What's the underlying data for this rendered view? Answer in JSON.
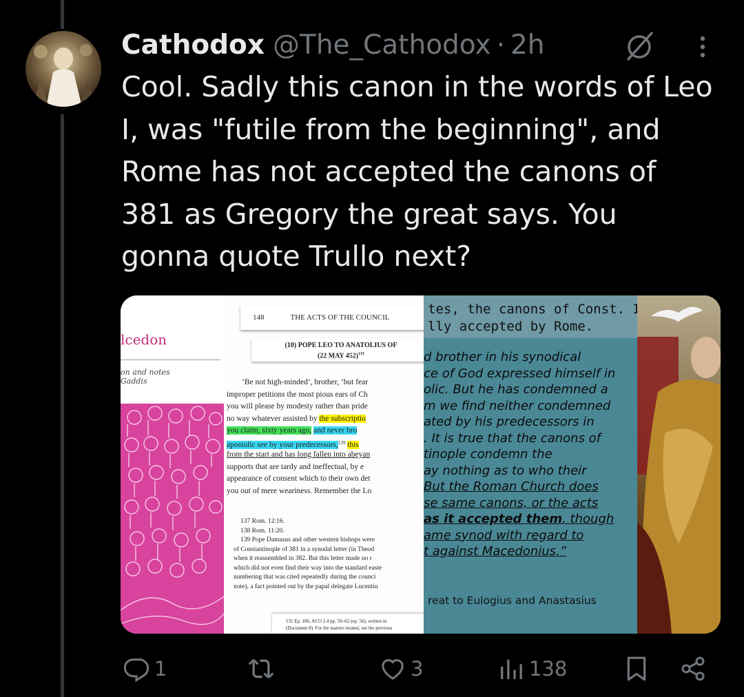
{
  "tweet": {
    "display_name": "Cathodox",
    "handle": "@The_Cathodox",
    "separator": "·",
    "time": "2h",
    "text": "Cool. Sadly this canon in the words of Leo I, was \"futile from the beginning\", and Rome has not accepted the canons of 381 as Gregory the great says. You gonna quote Trullo next?"
  },
  "media": {
    "book_cover": {
      "title": "lcedon",
      "subtitle_1": "on and notes",
      "subtitle_2": "Gaddis"
    },
    "book_page": {
      "page_number": "148",
      "running_title": "THE ACTS OF THE COUNCIL",
      "section_title": "(10) POPE LEO TO ANATOLIUS OF",
      "section_date": "(22 MAY 452)",
      "section_sup": "131",
      "lines": [
        "‘Be not high-minded’, brother, ‘but fear",
        "improper petitions the most pious ears of Ch",
        "you will please by modesty rather than pride",
        "no way whatever assisted by",
        "the subscriptio",
        "you claim, sixty years ago,",
        "and never bro",
        "apostolic see by your predecessors,",
        "139",
        "this",
        "from the start and has long fallen into abeyan",
        "supports that are tardy and ineffectual, by e",
        "appearance of consent which to their own det",
        "you out of mere weariness. Remember the Lo"
      ],
      "notes": [
        "137  Rom. 12:16.",
        "138  Rom. 11:20.",
        "139  Pope Damasus and other western bishops were",
        "of Constantinople of 381 in a synodal letter (in Theod",
        "when it reassembled in 382. But this letter made no r",
        "which did not even find their way into the standard easte",
        "numbering that was cited repeatedly during the counci",
        "note), a fact pointed out by the papal delegate Lucentiu"
      ],
      "footnote_1": "131  Ep. 106, ACO 2.4 pp. 59–62 (ep. 56), written in",
      "footnote_2": "(Document 8). For the matters treated, see the previous"
    },
    "teal_page": {
      "head_1": "tes, the canons of Const. I",
      "head_2": "lly accepted by Rome.",
      "quote": [
        "d brother in his synodical",
        "ce of God expressed himself in",
        "olic. But he has condemned a",
        "m we find neither condemned",
        "ated by his predecessors in",
        ". It is true that the canons of",
        "tinople condemn the",
        "ay nothing as to who their",
        "But the Roman Church does",
        "se same canons, or the acts",
        "as it accepted them",
        ", though",
        "ame synod with regard to",
        "t against Macedonius.”"
      ],
      "caption": "reat to Eulogius and Anastasius"
    }
  },
  "actions": {
    "replies": "1",
    "reposts": "",
    "likes": "3",
    "views": "138"
  },
  "colors": {
    "background": "#000000",
    "text": "#e7e9ea",
    "muted": "#71767b",
    "thread_line": "#333639",
    "teal": "#4a8896",
    "magenta": "#d8439e"
  },
  "icons": [
    "reply-icon",
    "repost-icon",
    "like-icon",
    "views-icon",
    "bookmark-icon",
    "share-icon",
    "grok-icon",
    "more-icon"
  ]
}
